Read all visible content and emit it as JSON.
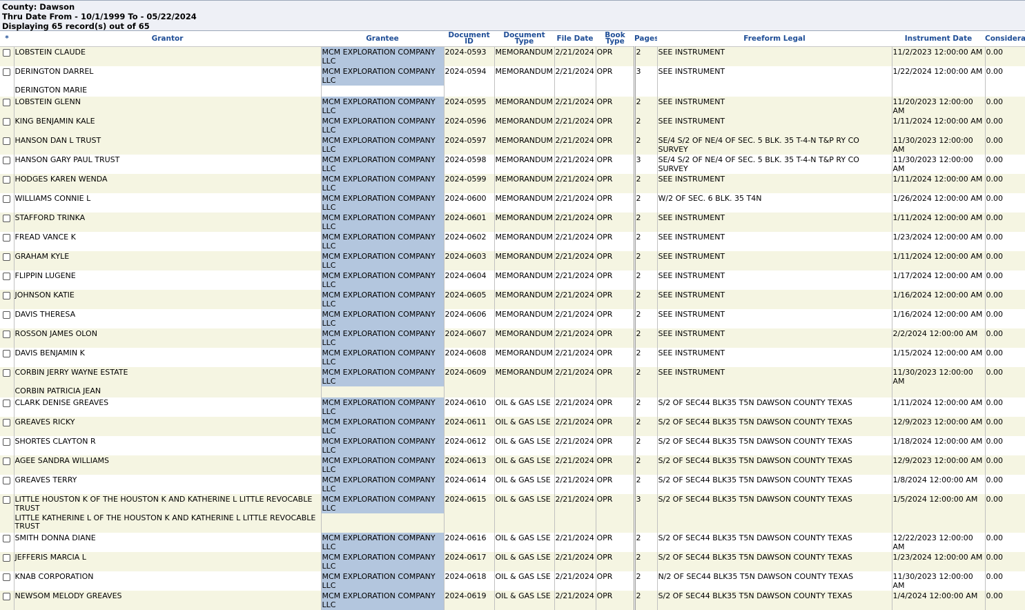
{
  "header": {
    "county": "County: Dawson",
    "range": "Thru Date From - 10/1/1999 To - 05/22/2024",
    "count": "Displaying 65 record(s) out of 65"
  },
  "columns": {
    "select": "*",
    "grantor": "Grantor",
    "grantee": "Grantee",
    "docid": "Document ID",
    "doctype": "Document Type",
    "filedate": "File Date",
    "booktype": "Book Type",
    "pages": "Pages",
    "legal": "Freeform Legal",
    "instr": "Instrument Date",
    "consid": "Considera"
  },
  "rows": [
    {
      "kind": "main",
      "alt": true,
      "grantor": "LOBSTEIN CLAUDE",
      "grantee": "MCM EXPLORATION COMPANY LLC",
      "docid": "2024-0593",
      "doctype": "MEMORANDUM",
      "filedate": "2/21/2024",
      "book": "OPR",
      "pages": "2",
      "legal": "SEE INSTRUMENT",
      "instr": "11/2/2023 12:00:00 AM",
      "consid": "0.00"
    },
    {
      "kind": "main",
      "alt": false,
      "grantor": "DERINGTON DARREL",
      "grantee": "MCM EXPLORATION COMPANY LLC",
      "docid": "2024-0594",
      "doctype": "MEMORANDUM",
      "filedate": "2/21/2024",
      "book": "OPR",
      "pages": "3",
      "legal": "SEE INSTRUMENT",
      "instr": "1/22/2024 12:00:00 AM",
      "consid": "0.00"
    },
    {
      "kind": "extra",
      "alt": false,
      "grantor": "DERINGTON MARIE"
    },
    {
      "kind": "main",
      "alt": true,
      "grantor": "LOBSTEIN GLENN",
      "grantee": "MCM EXPLORATION COMPANY LLC",
      "docid": "2024-0595",
      "doctype": "MEMORANDUM",
      "filedate": "2/21/2024",
      "book": "OPR",
      "pages": "2",
      "legal": "SEE INSTRUMENT",
      "instr": "11/20/2023 12:00:00 AM",
      "consid": "0.00"
    },
    {
      "kind": "main",
      "alt": true,
      "grantor": "KING BENJAMIN KALE",
      "grantee": "MCM EXPLORATION COMPANY LLC",
      "docid": "2024-0596",
      "doctype": "MEMORANDUM",
      "filedate": "2/21/2024",
      "book": "OPR",
      "pages": "2",
      "legal": "SEE INSTRUMENT",
      "instr": "1/11/2024 12:00:00 AM",
      "consid": "0.00"
    },
    {
      "kind": "main",
      "alt": true,
      "grantor": "HANSON DAN L TRUST",
      "grantee": "MCM EXPLORATION COMPANY LLC",
      "docid": "2024-0597",
      "doctype": "MEMORANDUM",
      "filedate": "2/21/2024",
      "book": "OPR",
      "pages": "2",
      "legal": "SE/4 S/2 OF NE/4 OF SEC. 5 BLK. 35 T-4-N T&P RY CO SURVEY",
      "instr": "11/30/2023 12:00:00 AM",
      "consid": "0.00"
    },
    {
      "kind": "main",
      "alt": false,
      "grantor": "HANSON GARY PAUL TRUST",
      "grantee": "MCM EXPLORATION COMPANY LLC",
      "docid": "2024-0598",
      "doctype": "MEMORANDUM",
      "filedate": "2/21/2024",
      "book": "OPR",
      "pages": "3",
      "legal": "SE/4 S/2 OF NE/4 OF SEC. 5 BLK. 35 T-4-N T&P RY CO SURVEY",
      "instr": "11/30/2023 12:00:00 AM",
      "consid": "0.00"
    },
    {
      "kind": "main",
      "alt": true,
      "grantor": "HODGES KAREN WENDA",
      "grantee": "MCM EXPLORATION COMPANY LLC",
      "docid": "2024-0599",
      "doctype": "MEMORANDUM",
      "filedate": "2/21/2024",
      "book": "OPR",
      "pages": "2",
      "legal": "SEE INSTRUMENT",
      "instr": "1/11/2024 12:00:00 AM",
      "consid": "0.00"
    },
    {
      "kind": "main",
      "alt": false,
      "grantor": "WILLIAMS CONNIE L",
      "grantee": "MCM EXPLORATION COMPANY LLC",
      "docid": "2024-0600",
      "doctype": "MEMORANDUM",
      "filedate": "2/21/2024",
      "book": "OPR",
      "pages": "2",
      "legal": "W/2 OF SEC. 6 BLK. 35 T4N",
      "instr": "1/26/2024 12:00:00 AM",
      "consid": "0.00"
    },
    {
      "kind": "main",
      "alt": true,
      "grantor": "STAFFORD TRINKA",
      "grantee": "MCM EXPLORATION COMPANY LLC",
      "docid": "2024-0601",
      "doctype": "MEMORANDUM",
      "filedate": "2/21/2024",
      "book": "OPR",
      "pages": "2",
      "legal": "SEE INSTRUMENT",
      "instr": "1/11/2024 12:00:00 AM",
      "consid": "0.00"
    },
    {
      "kind": "main",
      "alt": false,
      "grantor": "FREAD VANCE K",
      "grantee": "MCM EXPLORATION COMPANY LLC",
      "docid": "2024-0602",
      "doctype": "MEMORANDUM",
      "filedate": "2/21/2024",
      "book": "OPR",
      "pages": "2",
      "legal": "SEE INSTRUMENT",
      "instr": "1/23/2024 12:00:00 AM",
      "consid": "0.00"
    },
    {
      "kind": "main",
      "alt": true,
      "grantor": "GRAHAM KYLE",
      "grantee": "MCM EXPLORATION COMPANY LLC",
      "docid": "2024-0603",
      "doctype": "MEMORANDUM",
      "filedate": "2/21/2024",
      "book": "OPR",
      "pages": "2",
      "legal": "SEE INSTRUMENT",
      "instr": "1/11/2024 12:00:00 AM",
      "consid": "0.00"
    },
    {
      "kind": "main",
      "alt": false,
      "grantor": "FLIPPIN LUGENE",
      "grantee": "MCM EXPLORATION COMPANY LLC",
      "docid": "2024-0604",
      "doctype": "MEMORANDUM",
      "filedate": "2/21/2024",
      "book": "OPR",
      "pages": "2",
      "legal": "SEE INSTRUMENT",
      "instr": "1/17/2024 12:00:00 AM",
      "consid": "0.00"
    },
    {
      "kind": "main",
      "alt": true,
      "grantor": "JOHNSON KATIE",
      "grantee": "MCM EXPLORATION COMPANY LLC",
      "docid": "2024-0605",
      "doctype": "MEMORANDUM",
      "filedate": "2/21/2024",
      "book": "OPR",
      "pages": "2",
      "legal": "SEE INSTRUMENT",
      "instr": "1/16/2024 12:00:00 AM",
      "consid": "0.00"
    },
    {
      "kind": "main",
      "alt": false,
      "grantor": "DAVIS THERESA",
      "grantee": "MCM EXPLORATION COMPANY LLC",
      "docid": "2024-0606",
      "doctype": "MEMORANDUM",
      "filedate": "2/21/2024",
      "book": "OPR",
      "pages": "2",
      "legal": "SEE INSTRUMENT",
      "instr": "1/16/2024 12:00:00 AM",
      "consid": "0.00"
    },
    {
      "kind": "main",
      "alt": true,
      "grantor": "ROSSON JAMES OLON",
      "grantee": "MCM EXPLORATION COMPANY LLC",
      "docid": "2024-0607",
      "doctype": "MEMORANDUM",
      "filedate": "2/21/2024",
      "book": "OPR",
      "pages": "2",
      "legal": "SEE INSTRUMENT",
      "instr": "2/2/2024 12:00:00 AM",
      "consid": "0.00"
    },
    {
      "kind": "main",
      "alt": false,
      "grantor": "DAVIS BENJAMIN K",
      "grantee": "MCM EXPLORATION COMPANY LLC",
      "docid": "2024-0608",
      "doctype": "MEMORANDUM",
      "filedate": "2/21/2024",
      "book": "OPR",
      "pages": "2",
      "legal": "SEE INSTRUMENT",
      "instr": "1/15/2024 12:00:00 AM",
      "consid": "0.00"
    },
    {
      "kind": "main",
      "alt": true,
      "grantor": "CORBIN JERRY WAYNE ESTATE",
      "grantee": "MCM EXPLORATION COMPANY LLC",
      "docid": "2024-0609",
      "doctype": "MEMORANDUM",
      "filedate": "2/21/2024",
      "book": "OPR",
      "pages": "2",
      "legal": "SEE INSTRUMENT",
      "instr": "11/30/2023 12:00:00 AM",
      "consid": "0.00"
    },
    {
      "kind": "extra",
      "alt": true,
      "grantor": "CORBIN PATRICIA JEAN"
    },
    {
      "kind": "main",
      "alt": false,
      "grantor": "CLARK DENISE GREAVES",
      "grantee": "MCM EXPLORATION COMPANY LLC",
      "docid": "2024-0610",
      "doctype": "OIL & GAS LSE",
      "filedate": "2/21/2024",
      "book": "OPR",
      "pages": "2",
      "legal": "S/2 OF SEC44 BLK35 T5N DAWSON COUNTY TEXAS",
      "instr": "1/11/2024 12:00:00 AM",
      "consid": "0.00"
    },
    {
      "kind": "main",
      "alt": true,
      "grantor": "GREAVES RICKY",
      "grantee": "MCM EXPLORATION COMPANY LLC",
      "docid": "2024-0611",
      "doctype": "OIL & GAS LSE",
      "filedate": "2/21/2024",
      "book": "OPR",
      "pages": "2",
      "legal": "S/2 OF SEC44 BLK35 T5N DAWSON COUNTY TEXAS",
      "instr": "12/9/2023 12:00:00 AM",
      "consid": "0.00"
    },
    {
      "kind": "main",
      "alt": false,
      "grantor": "SHORTES CLAYTON R",
      "grantee": "MCM EXPLORATION COMPANY LLC",
      "docid": "2024-0612",
      "doctype": "OIL & GAS LSE",
      "filedate": "2/21/2024",
      "book": "OPR",
      "pages": "2",
      "legal": "S/2 OF SEC44 BLK35 T5N DAWSON COUNTY TEXAS",
      "instr": "1/18/2024 12:00:00 AM",
      "consid": "0.00"
    },
    {
      "kind": "main",
      "alt": true,
      "grantor": "AGEE SANDRA WILLIAMS",
      "grantee": "MCM EXPLORATION COMPANY LLC",
      "docid": "2024-0613",
      "doctype": "OIL & GAS LSE",
      "filedate": "2/21/2024",
      "book": "OPR",
      "pages": "2",
      "legal": "S/2 OF SEC44 BLK35 T5N DAWSON COUNTY TEXAS",
      "instr": "12/9/2023 12:00:00 AM",
      "consid": "0.00"
    },
    {
      "kind": "main",
      "alt": false,
      "grantor": "GREAVES TERRY",
      "grantee": "MCM EXPLORATION COMPANY LLC",
      "docid": "2024-0614",
      "doctype": "OIL & GAS LSE",
      "filedate": "2/21/2024",
      "book": "OPR",
      "pages": "2",
      "legal": "S/2 OF SEC44 BLK35 T5N DAWSON COUNTY TEXAS",
      "instr": "1/8/2024 12:00:00 AM",
      "consid": "0.00"
    },
    {
      "kind": "main",
      "alt": true,
      "grantor": "LITTLE HOUSTON K OF THE HOUSTON K AND KATHERINE L LITTLE REVOCABLE TRUST",
      "grantee": "MCM EXPLORATION COMPANY LLC",
      "docid": "2024-0615",
      "doctype": "OIL & GAS LSE",
      "filedate": "2/21/2024",
      "book": "OPR",
      "pages": "3",
      "legal": "S/2 OF SEC44 BLK35 T5N DAWSON COUNTY TEXAS",
      "instr": "1/5/2024 12:00:00 AM",
      "consid": "0.00"
    },
    {
      "kind": "extra2",
      "alt": true,
      "grantor": "LITTLE KATHERINE L OF THE HOUSTON K AND KATHERINE L LITTLE REVOCABLE TRUST"
    },
    {
      "kind": "main",
      "alt": false,
      "grantor": "SMITH DONNA DIANE",
      "grantee": "MCM EXPLORATION COMPANY LLC",
      "docid": "2024-0616",
      "doctype": "OIL & GAS LSE",
      "filedate": "2/21/2024",
      "book": "OPR",
      "pages": "2",
      "legal": "S/2 OF SEC44 BLK35 T5N DAWSON COUNTY TEXAS",
      "instr": "12/22/2023 12:00:00 AM",
      "consid": "0.00"
    },
    {
      "kind": "main",
      "alt": true,
      "grantor": "JEFFERIS MARCIA L",
      "grantee": "MCM EXPLORATION COMPANY LLC",
      "docid": "2024-0617",
      "doctype": "OIL & GAS LSE",
      "filedate": "2/21/2024",
      "book": "OPR",
      "pages": "2",
      "legal": "S/2 OF SEC44 BLK35 T5N DAWSON COUNTY TEXAS",
      "instr": "1/23/2024 12:00:00 AM",
      "consid": "0.00"
    },
    {
      "kind": "main",
      "alt": false,
      "grantor": "KNAB CORPORATION",
      "grantee": "MCM EXPLORATION COMPANY LLC",
      "docid": "2024-0618",
      "doctype": "OIL & GAS LSE",
      "filedate": "2/21/2024",
      "book": "OPR",
      "pages": "2",
      "legal": "N/2 OF SEC44 BLK35 T5N DAWSON COUNTY TEXAS",
      "instr": "11/30/2023 12:00:00 AM",
      "consid": "0.00"
    },
    {
      "kind": "main",
      "alt": true,
      "grantor": "NEWSOM MELODY GREAVES",
      "grantee": "MCM EXPLORATION COMPANY LLC",
      "docid": "2024-0619",
      "doctype": "OIL & GAS LSE",
      "filedate": "2/21/2024",
      "book": "OPR",
      "pages": "2",
      "legal": "S/2 OF SEC44 BLK35 T5N DAWSON COUNTY TEXAS",
      "instr": "1/4/2024 12:00:00 AM",
      "consid": "0.00"
    }
  ]
}
